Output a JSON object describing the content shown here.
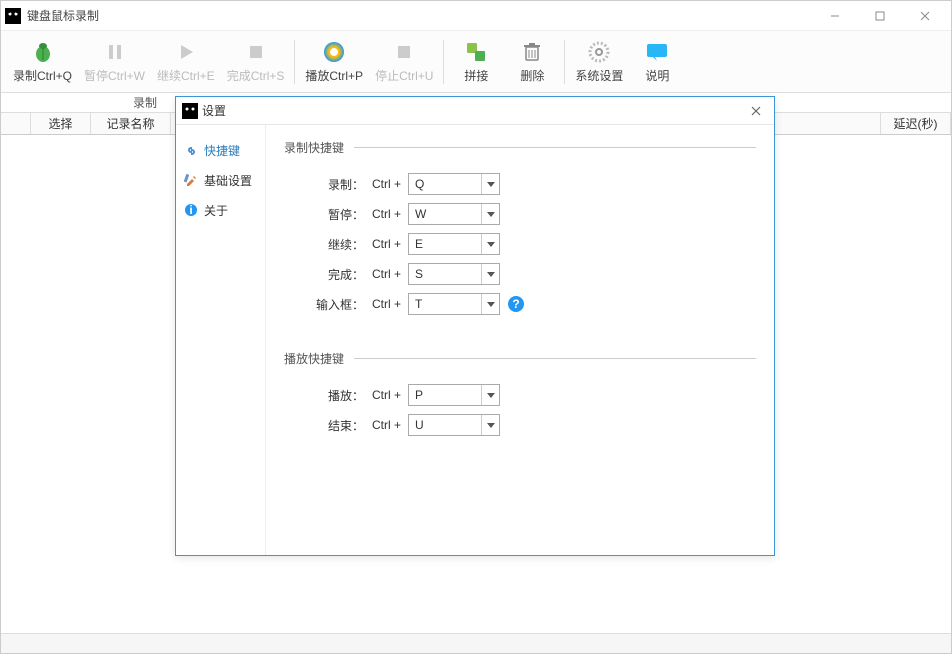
{
  "window": {
    "title": "键盘鼠标录制"
  },
  "toolbar": {
    "record": "录制Ctrl+Q",
    "pause": "暂停Ctrl+W",
    "resume": "继续Ctrl+E",
    "finish": "完成Ctrl+S",
    "play": "播放Ctrl+P",
    "stop": "停止Ctrl+U",
    "join": "拼接",
    "delete": "删除",
    "settings": "系统设置",
    "help": "说明"
  },
  "subrow": {
    "label": "录制"
  },
  "columns": {
    "select": "选择",
    "name": "记录名称",
    "delay": "延迟(秒)"
  },
  "dialog": {
    "title": "设置",
    "side": {
      "shortcuts": "快捷键",
      "basic": "基础设置",
      "about": "关于"
    },
    "section1": "录制快捷键",
    "section2": "播放快捷键",
    "ctrl": "Ctrl +",
    "labels": {
      "record": "录制：",
      "pause": "暂停：",
      "resume": "继续：",
      "finish": "完成：",
      "input": "输入框：",
      "play": "播放：",
      "end": "结束："
    },
    "keys": {
      "record": "Q",
      "pause": "W",
      "resume": "E",
      "finish": "S",
      "input": "T",
      "play": "P",
      "end": "U"
    }
  }
}
